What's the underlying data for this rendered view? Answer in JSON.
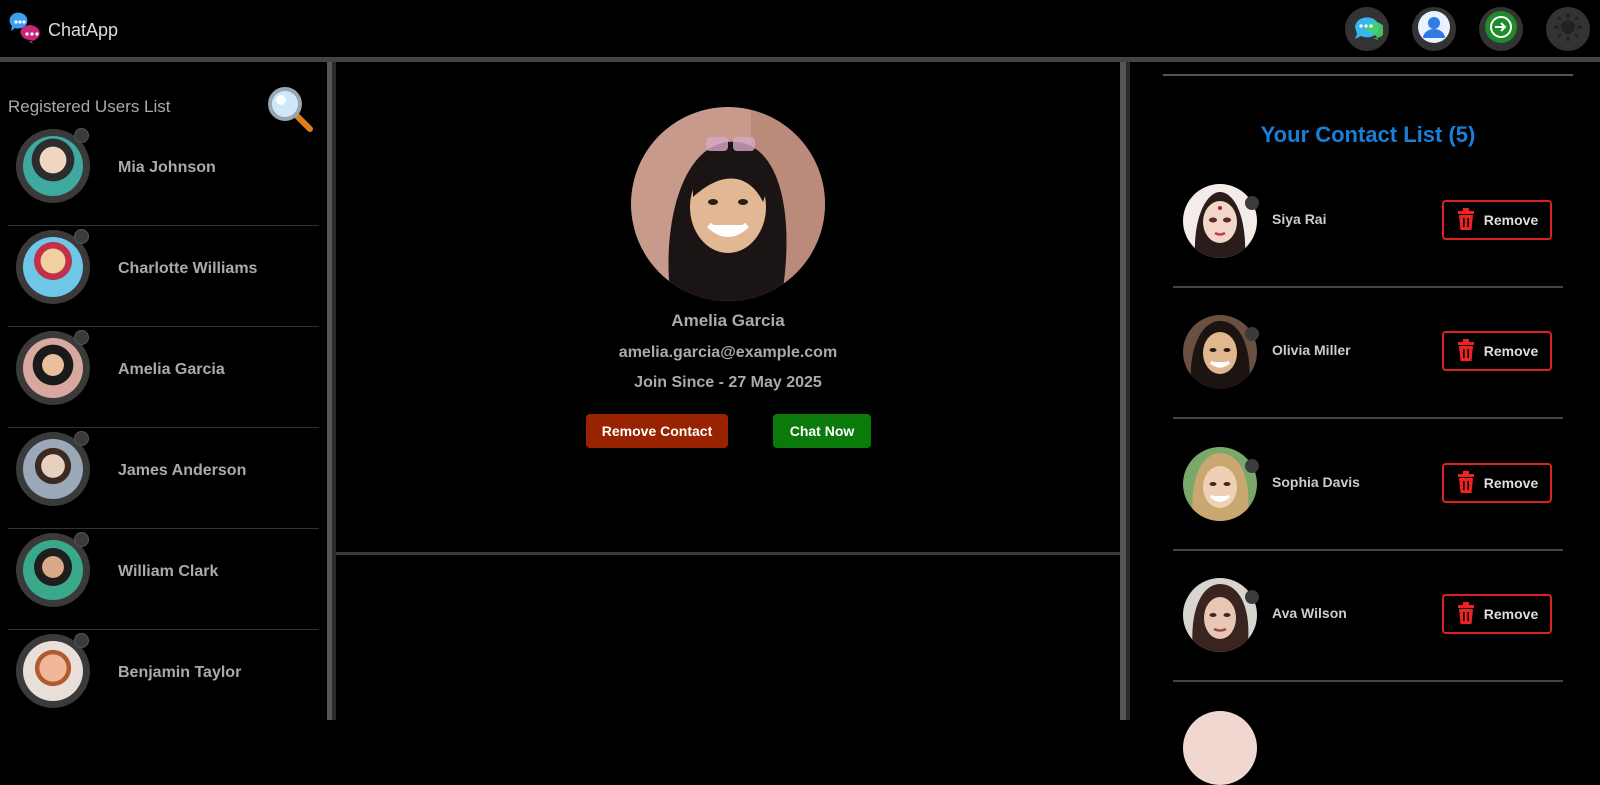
{
  "app": {
    "title": "ChatApp"
  },
  "nav": {
    "icons": [
      "chat-icon",
      "profile-icon",
      "login-icon",
      "settings-icon"
    ]
  },
  "left": {
    "heading": "Registered Users List",
    "users": [
      {
        "name": "Mia Johnson"
      },
      {
        "name": "Charlotte Williams"
      },
      {
        "name": "Amelia Garcia"
      },
      {
        "name": "James Anderson"
      },
      {
        "name": "William Clark"
      },
      {
        "name": "Benjamin Taylor"
      }
    ]
  },
  "profile": {
    "name": "Amelia Garcia",
    "email": "amelia.garcia@example.com",
    "join": "Join Since - 27 May 2025",
    "remove_label": "Remove Contact",
    "chat_label": "Chat Now"
  },
  "contacts": {
    "title": "Your Contact List (5)",
    "remove_label": "Remove",
    "items": [
      {
        "name": "Siya Rai"
      },
      {
        "name": "Olivia Miller"
      },
      {
        "name": "Sophia Davis"
      },
      {
        "name": "Ava Wilson"
      }
    ]
  },
  "colors": {
    "accent_blue": "#1a7fd6",
    "danger_red": "#992200",
    "success_green": "#0a7a0a",
    "border_red": "#dd2222"
  }
}
